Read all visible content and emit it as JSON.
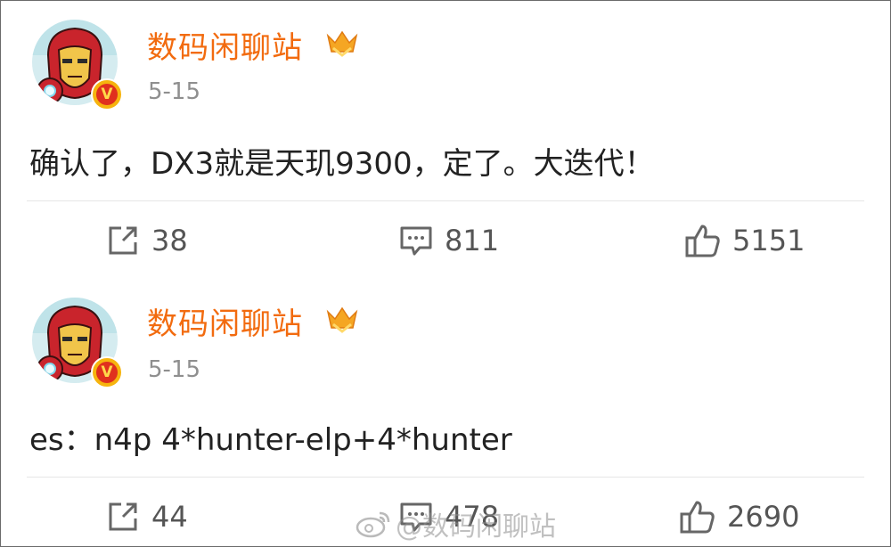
{
  "posts": [
    {
      "username": "数码闲聊站",
      "date": "5-15",
      "verified_badge": "V",
      "content": "确认了，DX3就是天玑9300，定了。大迭代！",
      "actions": {
        "repost": "38",
        "comment": "811",
        "like": "5151"
      }
    },
    {
      "username": "数码闲聊站",
      "date": "5-15",
      "verified_badge": "V",
      "content": "es：n4p 4*hunter-elp+4*hunter",
      "actions": {
        "repost": "44",
        "comment": "478",
        "like": "2690"
      }
    }
  ],
  "watermark": "@数码闲聊站",
  "icons": {
    "avatar": "iron-man-avatar",
    "level": "crown-level-icon",
    "repost": "share-icon",
    "comment": "comment-icon",
    "like": "thumbs-up-icon"
  },
  "colors": {
    "username": "#f26b0f",
    "date": "#8f8f8f",
    "text": "#222222",
    "badge": "#e0301e"
  }
}
